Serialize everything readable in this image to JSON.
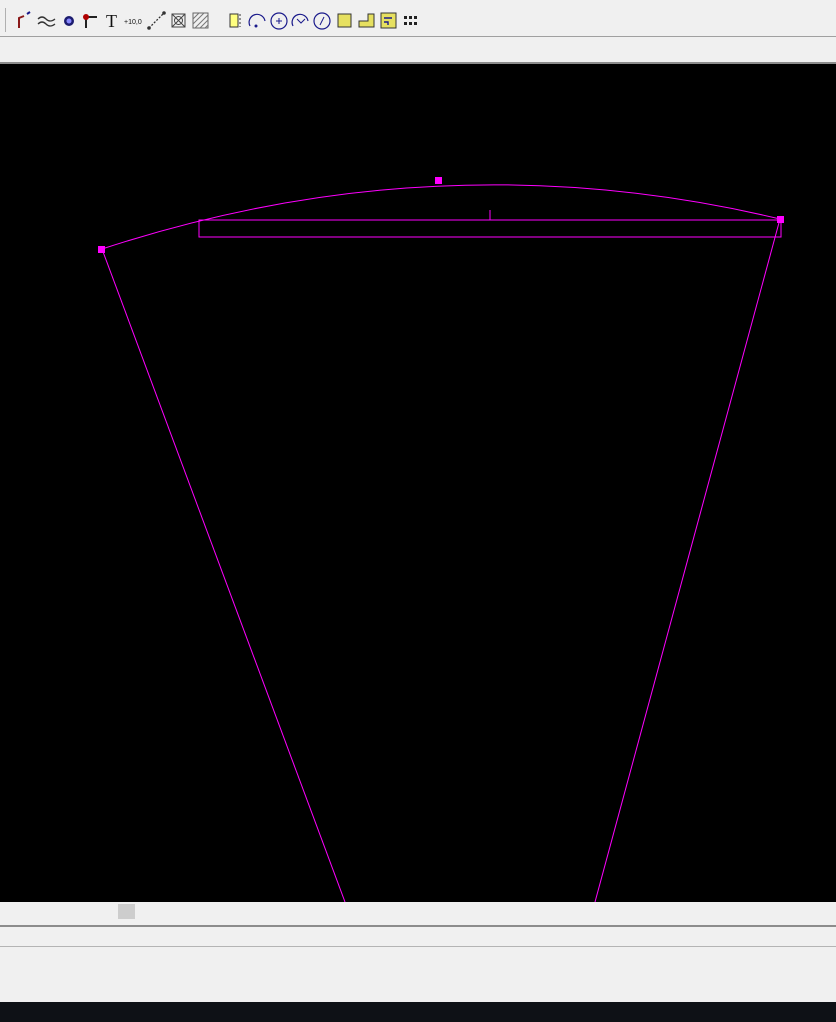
{
  "colors": {
    "canvas_background": "#000000",
    "entity_stroke": "#ff00ff",
    "grip": "#ff00ff",
    "toolbar_background": "#f0f0f0",
    "taskbar": "#0e1116"
  },
  "toolbar": {
    "text_tool_glyph": "T",
    "coordinate_tool_glyph": "+10,0",
    "buttons": [
      {
        "icon": "polyline-icon"
      },
      {
        "icon": "spline-icon"
      },
      {
        "icon": "point-icon"
      },
      {
        "icon": "leader-icon"
      },
      {
        "icon": "text-icon"
      },
      {
        "icon": "coordinate-icon"
      },
      {
        "icon": "measure-line-icon"
      },
      {
        "icon": "hatch-cross-icon"
      },
      {
        "icon": "hatch-diagonal-icon"
      },
      {
        "icon": "block-icon"
      },
      {
        "icon": "arc-3point-icon"
      },
      {
        "icon": "arc-center-icon"
      },
      {
        "icon": "arc-tangent-icon"
      },
      {
        "icon": "circle-icon"
      },
      {
        "icon": "fill-region-icon"
      },
      {
        "icon": "fill-corner-icon"
      },
      {
        "icon": "fill-pattern-icon"
      },
      {
        "icon": "array-icon"
      }
    ]
  }
}
